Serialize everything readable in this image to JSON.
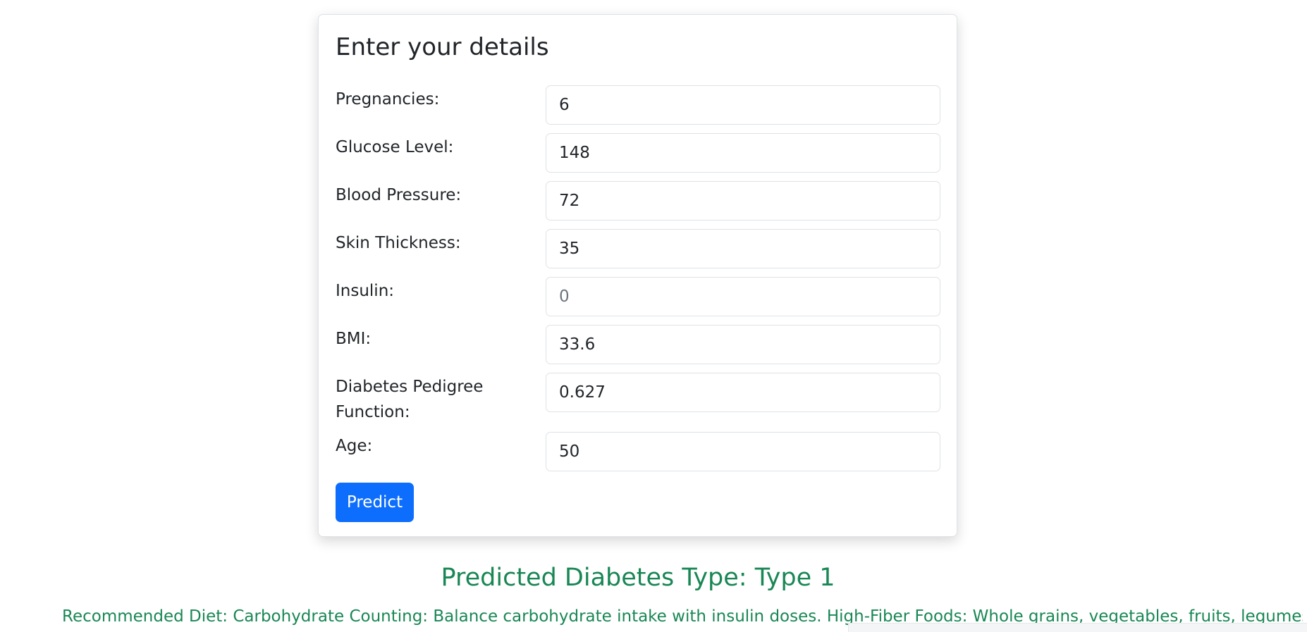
{
  "form": {
    "title": "Enter your details",
    "fields": [
      {
        "label": "Pregnancies:",
        "value": "6",
        "placeholder": ""
      },
      {
        "label": "Glucose Level:",
        "value": "148",
        "placeholder": ""
      },
      {
        "label": "Blood Pressure:",
        "value": "72",
        "placeholder": ""
      },
      {
        "label": "Skin Thickness:",
        "value": "35",
        "placeholder": ""
      },
      {
        "label": "Insulin:",
        "value": "",
        "placeholder": "0"
      },
      {
        "label": "BMI:",
        "value": "33.6",
        "placeholder": ""
      },
      {
        "label": "Diabetes Pedigree Function:",
        "value": "0.627",
        "placeholder": ""
      },
      {
        "label": "Age:",
        "value": "50",
        "placeholder": ""
      }
    ],
    "submit_label": "Predict"
  },
  "result": {
    "title": "Predicted Diabetes Type: Type 1",
    "diet": "Recommended Diet: Carbohydrate Counting: Balance carbohydrate intake with insulin doses. High-Fiber Foods: Whole grains, vegetables, fruits, legumes."
  },
  "colors": {
    "primary": "#0d6efd",
    "success": "#198754",
    "border": "#dee2e6",
    "text": "#212529"
  }
}
